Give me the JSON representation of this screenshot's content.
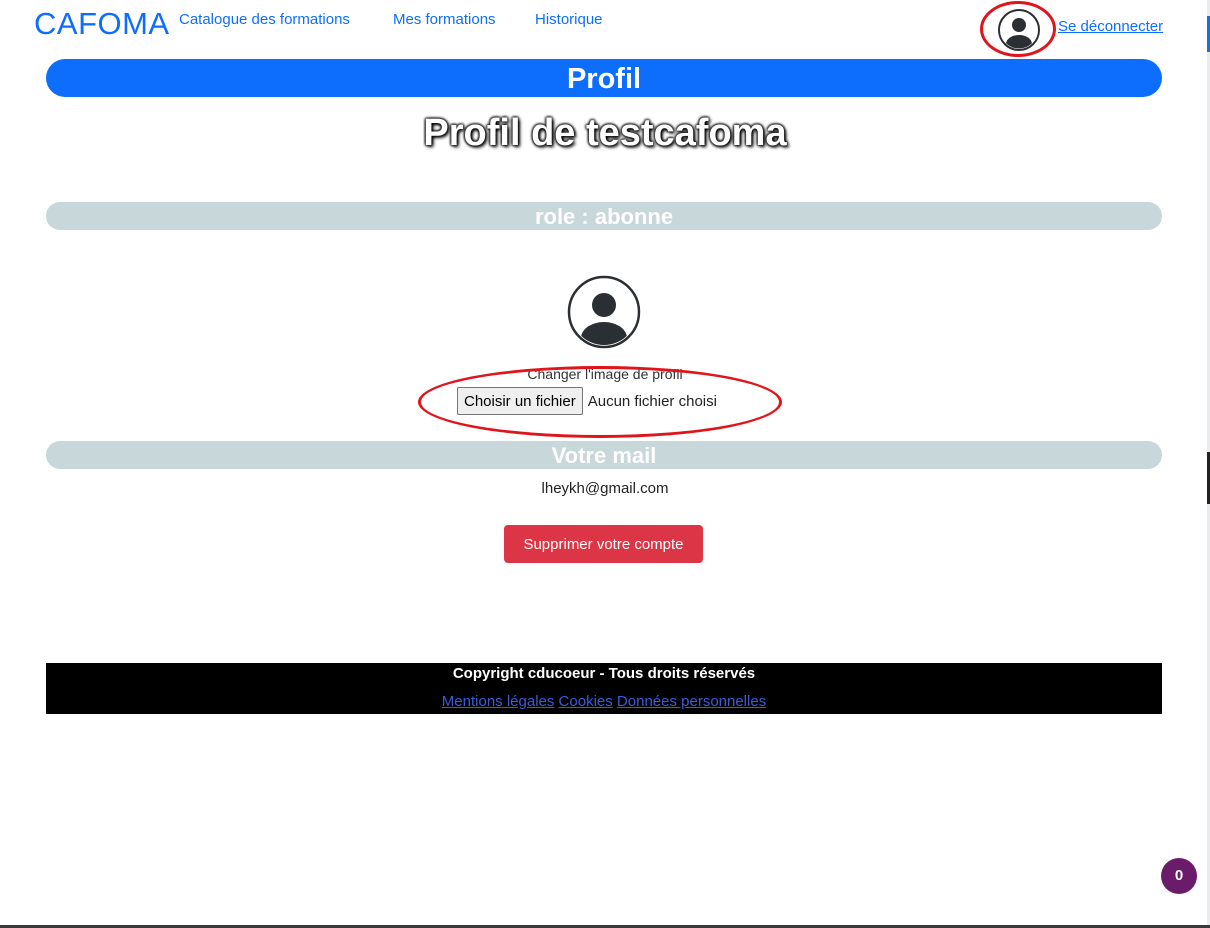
{
  "nav": {
    "brand": "CAFOMA",
    "links": [
      "Catalogue des formations",
      "Mes formations",
      "Historique"
    ],
    "logout": "Se déconnecter"
  },
  "profile_banner": "Profil",
  "profile_heading": "Profil de testcafoma",
  "role_banner": "role : abonne",
  "avatar": {
    "icon": "user-circle-icon",
    "change_label": "Changer l'image de profil"
  },
  "file_input": {
    "button_label": "Choisir un fichier",
    "status": "Aucun fichier choisi"
  },
  "mail_banner": "Votre mail",
  "email": "lheykh@gmail.com",
  "delete_button": "Supprimer votre compte",
  "footer": {
    "copyright": "Copyright cducoeur - Tous droits réservés",
    "links": [
      "Mentions légales",
      "Cookies",
      "Données personnelles"
    ]
  },
  "badge_count": "0",
  "colors": {
    "primary": "#0d6efd",
    "danger": "#dc3545",
    "banner_grey": "#c8d7da",
    "annotation_red": "#e0141b"
  }
}
